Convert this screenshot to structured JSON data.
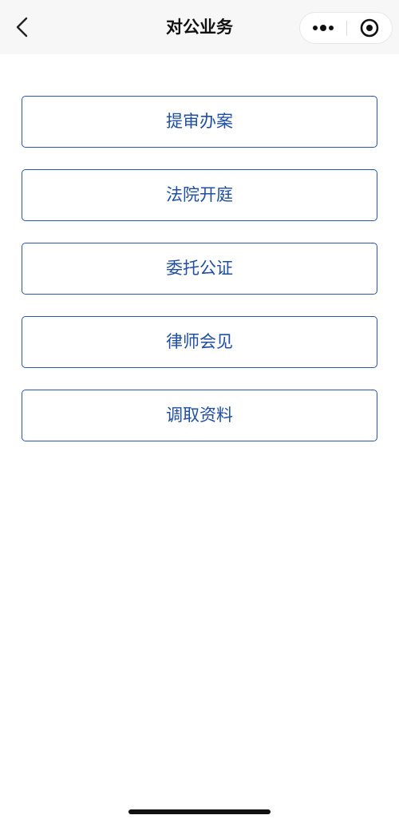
{
  "header": {
    "title": "对公业务"
  },
  "menu": {
    "items": [
      {
        "label": "提审办案"
      },
      {
        "label": "法院开庭"
      },
      {
        "label": "委托公证"
      },
      {
        "label": "律师会见"
      },
      {
        "label": "调取资料"
      }
    ]
  },
  "colors": {
    "accent": "#1f4ea3",
    "border": "#2a56a6",
    "navbar_bg": "#f7f7f7"
  }
}
